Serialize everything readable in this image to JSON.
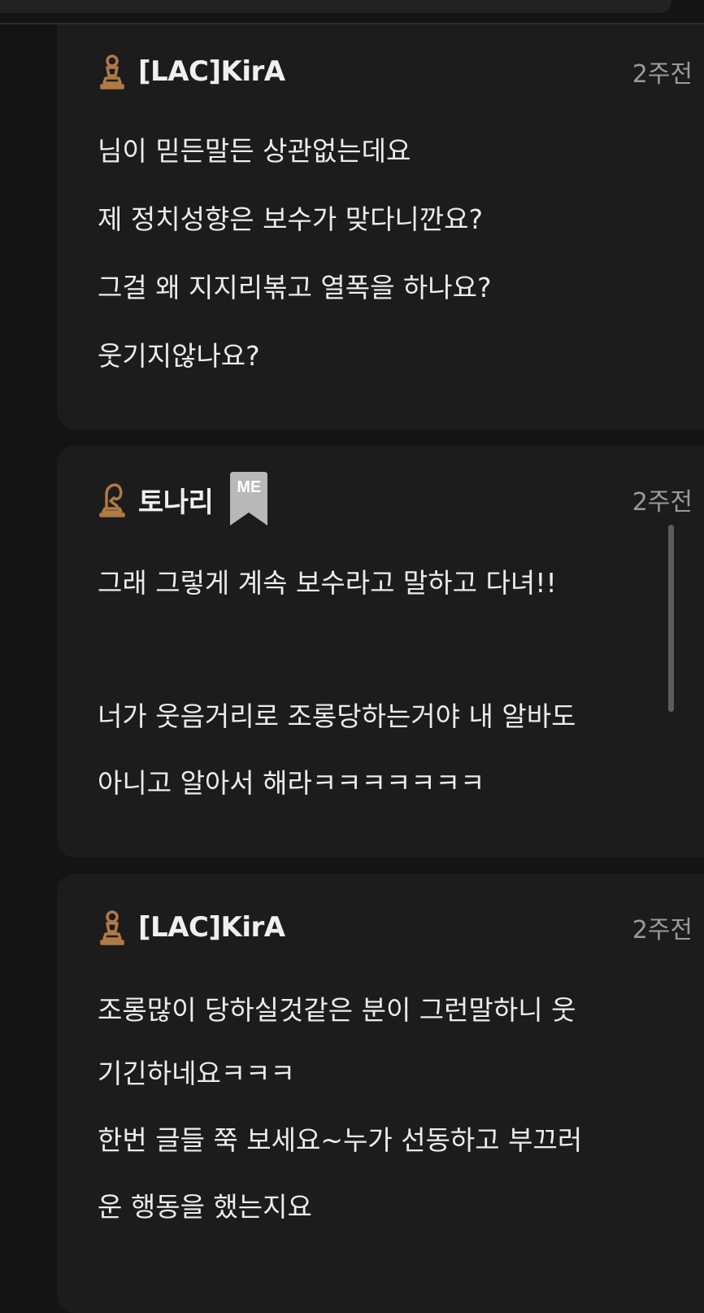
{
  "colors": {
    "background": "#141414",
    "card": "#1c1c1c",
    "text": "#ececec",
    "muted": "#9a9a9a",
    "rank_icon": "#b07a45",
    "badge": "#b8b8b8"
  },
  "comments": [
    {
      "username": "[LAC]KirA",
      "rank_icon": "pawn-icon",
      "time": "2주전",
      "lines": [
        "님이 믿든말든 상관없는데요",
        "제 정치성향은 보수가 맞다니깐요?",
        "그걸 왜 지지리볶고 열폭을 하나요?",
        "웃기지않나요?"
      ]
    },
    {
      "username": "토나리",
      "rank_icon": "knight-icon",
      "badge": "ME",
      "time": "2주전",
      "lines": [
        "그래 그렇게 계속 보수라고 말하고 다녀!!",
        "너가 웃음거리로 조롱당하는거야 내 알바도",
        "아니고 알아서 해라ㅋㅋㅋㅋㅋㅋㅋ"
      ]
    },
    {
      "username": "[LAC]KirA",
      "rank_icon": "pawn-icon",
      "time": "2주전",
      "lines": [
        "조롱많이 당하실것같은 분이 그런말하니 웃",
        "기긴하네요ㅋㅋㅋ",
        "한번 글들 쭉 보세요~누가 선동하고 부끄러",
        "운 행동을 했는지요"
      ]
    }
  ]
}
